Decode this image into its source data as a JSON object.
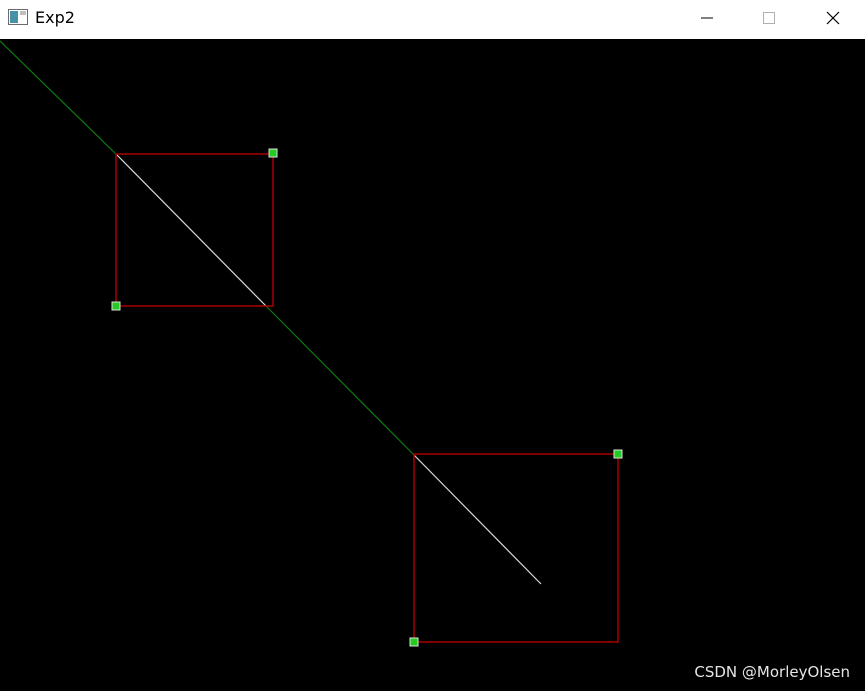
{
  "window": {
    "title": "Exp2",
    "controls": {
      "minimize": "minimize-icon",
      "maximize": "maximize-icon",
      "close": "close-icon"
    }
  },
  "colors": {
    "background": "#000000",
    "rect_stroke": "#a80000",
    "line_green": "#0f7a0f",
    "line_white": "#d9d9d9",
    "vertex_green": "#22cc22"
  },
  "watermark": "CSDN @MorleyOlsen"
}
